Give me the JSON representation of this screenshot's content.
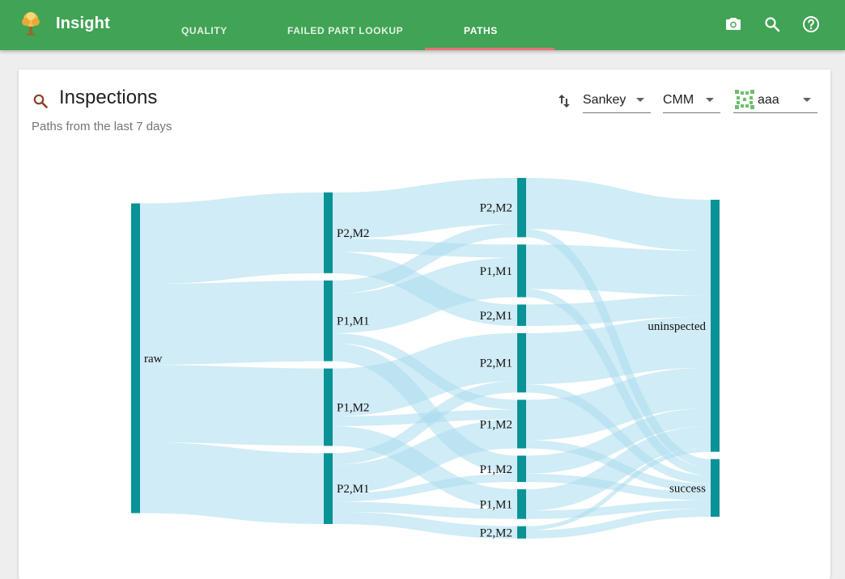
{
  "app": {
    "title": "Insight"
  },
  "tabs": [
    {
      "label": "QUALITY",
      "active": false
    },
    {
      "label": "FAILED PART LOOKUP",
      "active": false
    },
    {
      "label": "PATHS",
      "active": true
    }
  ],
  "toolbar_icons": [
    "camera-icon",
    "search-icon",
    "help-icon"
  ],
  "card": {
    "title": "Inspections",
    "subtitle": "Paths from the last 7 days",
    "chart_type_select": {
      "value": "Sankey"
    },
    "measure_select": {
      "value": "CMM"
    },
    "part_select": {
      "value": "aaa"
    }
  },
  "colors": {
    "header": "#41a354",
    "node": "#0a9396",
    "link": "#a9dcee",
    "tab_indicator": "#e57373"
  },
  "sankey": {
    "columns": [
      [
        "raw"
      ],
      [
        "P2,M2",
        "P1,M1",
        "P1,M2",
        "P2,M1"
      ],
      [
        "P2,M2",
        "P1,M1",
        "P2,M1",
        "P2,M1",
        "P1,M2",
        "P1,M2",
        "P1,M1",
        "P2,M2"
      ],
      [
        "uninspected",
        "success"
      ]
    ],
    "nodes": [
      {
        "id": "raw",
        "label": "raw",
        "column": 0
      },
      {
        "id": "a_p2m2",
        "label": "P2,M2",
        "column": 1
      },
      {
        "id": "a_p1m1",
        "label": "P1,M1",
        "column": 1
      },
      {
        "id": "a_p1m2",
        "label": "P1,M2",
        "column": 1
      },
      {
        "id": "a_p2m1",
        "label": "P2,M1",
        "column": 1
      },
      {
        "id": "b_p2m2",
        "label": "P2,M2",
        "column": 2
      },
      {
        "id": "b_p1m1",
        "label": "P1,M1",
        "column": 2
      },
      {
        "id": "b_p2m1a",
        "label": "P2,M1",
        "column": 2
      },
      {
        "id": "b_p2m1b",
        "label": "P2,M1",
        "column": 2
      },
      {
        "id": "b_p1m2a",
        "label": "P1,M2",
        "column": 2
      },
      {
        "id": "b_p1m2b",
        "label": "P1,M2",
        "column": 2
      },
      {
        "id": "b_p1m1b",
        "label": "P1,M1",
        "column": 2
      },
      {
        "id": "b_p2m2b",
        "label": "P2,M2",
        "column": 2
      },
      {
        "id": "uninspected",
        "label": "uninspected",
        "column": 3
      },
      {
        "id": "success",
        "label": "success",
        "column": 3
      }
    ],
    "links": [
      {
        "source": "raw",
        "target": "a_p2m2",
        "value": 98
      },
      {
        "source": "raw",
        "target": "a_p1m1",
        "value": 98
      },
      {
        "source": "raw",
        "target": "a_p1m2",
        "value": 94
      },
      {
        "source": "raw",
        "target": "a_p2m1",
        "value": 86
      },
      {
        "source": "a_p2m2",
        "target": "b_p2m2",
        "value": 56
      },
      {
        "source": "a_p2m2",
        "target": "b_p1m1",
        "value": 16
      },
      {
        "source": "a_p2m2",
        "target": "b_p2m1a",
        "value": 26
      },
      {
        "source": "a_p1m1",
        "target": "b_p2m2",
        "value": 16
      },
      {
        "source": "a_p1m1",
        "target": "b_p1m1",
        "value": 48
      },
      {
        "source": "a_p1m1",
        "target": "b_p1m2a",
        "value": 12
      },
      {
        "source": "a_p1m1",
        "target": "b_p1m2b",
        "value": 22
      },
      {
        "source": "a_p1m2",
        "target": "b_p2m1b",
        "value": 58
      },
      {
        "source": "a_p1m2",
        "target": "b_p1m2a",
        "value": 12
      },
      {
        "source": "a_p1m2",
        "target": "b_p1m1b",
        "value": 24
      },
      {
        "source": "a_p2m1",
        "target": "b_p2m1b",
        "value": 14
      },
      {
        "source": "a_p2m1",
        "target": "b_p1m2a",
        "value": 35
      },
      {
        "source": "a_p2m1",
        "target": "b_p1m1b",
        "value": 12
      },
      {
        "source": "a_p2m1",
        "target": "b_p2m2b",
        "value": 15
      },
      {
        "source": "a_p2m1",
        "target": "b_p1m2b",
        "value": 10
      },
      {
        "source": "b_p2m2",
        "target": "uninspected",
        "value": 62
      },
      {
        "source": "b_p2m2",
        "target": "success",
        "value": 10
      },
      {
        "source": "b_p1m1",
        "target": "uninspected",
        "value": 54
      },
      {
        "source": "b_p1m1",
        "target": "success",
        "value": 10
      },
      {
        "source": "b_p2m1a",
        "target": "uninspected",
        "value": 26
      },
      {
        "source": "b_p2m1b",
        "target": "uninspected",
        "value": 62
      },
      {
        "source": "b_p2m1b",
        "target": "success",
        "value": 10
      },
      {
        "source": "b_p1m2a",
        "target": "uninspected",
        "value": 49
      },
      {
        "source": "b_p1m2a",
        "target": "success",
        "value": 10
      },
      {
        "source": "b_p1m2b",
        "target": "uninspected",
        "value": 22
      },
      {
        "source": "b_p1m2b",
        "target": "success",
        "value": 10
      },
      {
        "source": "b_p1m1b",
        "target": "uninspected",
        "value": 26
      },
      {
        "source": "b_p1m1b",
        "target": "success",
        "value": 10
      },
      {
        "source": "b_p2m2b",
        "target": "uninspected",
        "value": 5
      },
      {
        "source": "b_p2m2b",
        "target": "success",
        "value": 10
      }
    ]
  }
}
